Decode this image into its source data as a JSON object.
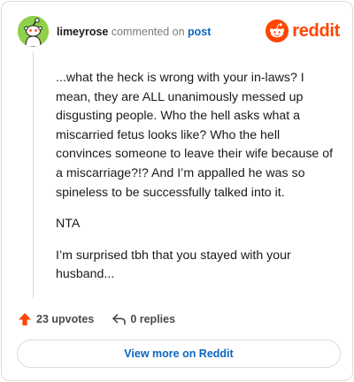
{
  "comment": {
    "username": "limeyrose",
    "action_text": "commented on",
    "post_link": "post",
    "avatar_icon": "snoo-avatar-icon",
    "paragraphs": [
      "...what the heck is wrong with your in-laws? I mean, they are ALL unanimously messed up disgusting people. Who the hell asks what a miscarried fetus looks like? Who the hell convinces someone to leave their wife because of a miscarriage?!? And I’m appalled he was so spineless to be successfully talked into it.",
      "NTA",
      "I’m surprised tbh that you stayed with your husband..."
    ]
  },
  "brand": {
    "wordmark": "reddit",
    "icon": "reddit-logo-icon",
    "color": "#ff4500"
  },
  "actions": {
    "upvotes": "23 upvotes",
    "replies": "0 replies",
    "upvote_icon": "upvote-arrow-icon",
    "reply_icon": "reply-arrow-icon"
  },
  "footer": {
    "view_more": "View more on Reddit"
  },
  "colors": {
    "accent": "#ff4500",
    "link": "#0a66c2",
    "avatar_bg": "#8fd14a",
    "border": "#dcdcdc"
  }
}
